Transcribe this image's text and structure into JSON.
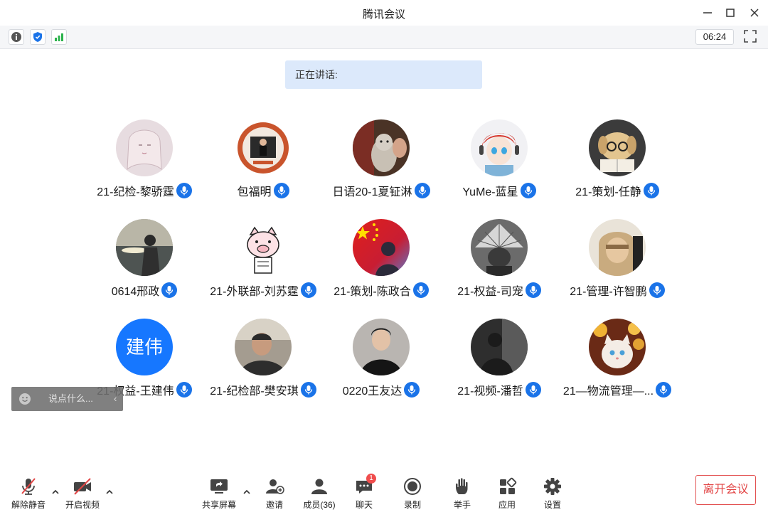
{
  "window": {
    "title": "腾讯会议"
  },
  "infobar": {
    "timer": "06:24"
  },
  "speaking": {
    "label": "正在讲话:"
  },
  "participants": [
    {
      "name": "21-纪检-黎骄霆",
      "avatar": "girl-sketch"
    },
    {
      "name": "包福明",
      "avatar": "stage-speaker"
    },
    {
      "name": "日语20-1夏钲淋",
      "avatar": "cat-photo"
    },
    {
      "name": "YuMe-蓝星",
      "avatar": "anime-red-hair"
    },
    {
      "name": "21-策划-任静",
      "avatar": "dog-with-glasses"
    },
    {
      "name": "0614邢政",
      "avatar": "sunset-person"
    },
    {
      "name": "21-外联部-刘苏霆",
      "avatar": "cartoon-pig"
    },
    {
      "name": "21-策划-陈政合",
      "avatar": "flag-silhouette"
    },
    {
      "name": "21-权益-司宠",
      "avatar": "fan-face"
    },
    {
      "name": "21-管理-许智鹏",
      "avatar": "hooded-figure"
    },
    {
      "name": "21-权益-王建伟",
      "avatar": "text",
      "avatar_text": "建伟",
      "avatar_color": "#1677ff"
    },
    {
      "name": "21-纪检部-樊安琪",
      "avatar": "man-photo"
    },
    {
      "name": "0220王友达",
      "avatar": "young-man"
    },
    {
      "name": "21-视频-潘哲",
      "avatar": "dark-silhouette"
    },
    {
      "name": "21—物流管理—...",
      "avatar": "cat-flowers"
    }
  ],
  "chat": {
    "placeholder": "说点什么..."
  },
  "toolbar": {
    "unmute": "解除静音",
    "start_video": "开启视频",
    "share_screen": "共享屏幕",
    "invite": "邀请",
    "members": "成员(36)",
    "chat": "聊天",
    "chat_unread": "1",
    "record": "录制",
    "raise_hand": "举手",
    "apps": "应用",
    "settings": "设置",
    "leave": "离开会议"
  },
  "colors": {
    "accent": "#1a73e8",
    "leave": "#e24545",
    "speaking_bg": "#dce9fb",
    "badge": "#f04d4d"
  }
}
